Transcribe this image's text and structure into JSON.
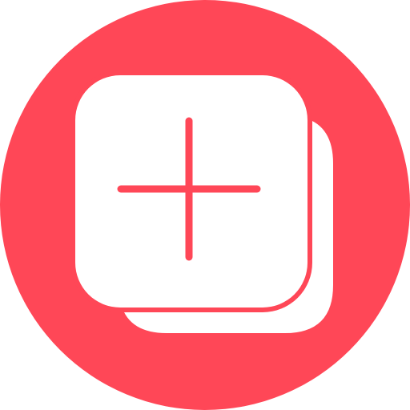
{
  "icon": {
    "name": "add-layer-icon",
    "colors": {
      "circle": "#FF4757",
      "card": "#FFFFFF",
      "plus": "#FF4757"
    }
  }
}
